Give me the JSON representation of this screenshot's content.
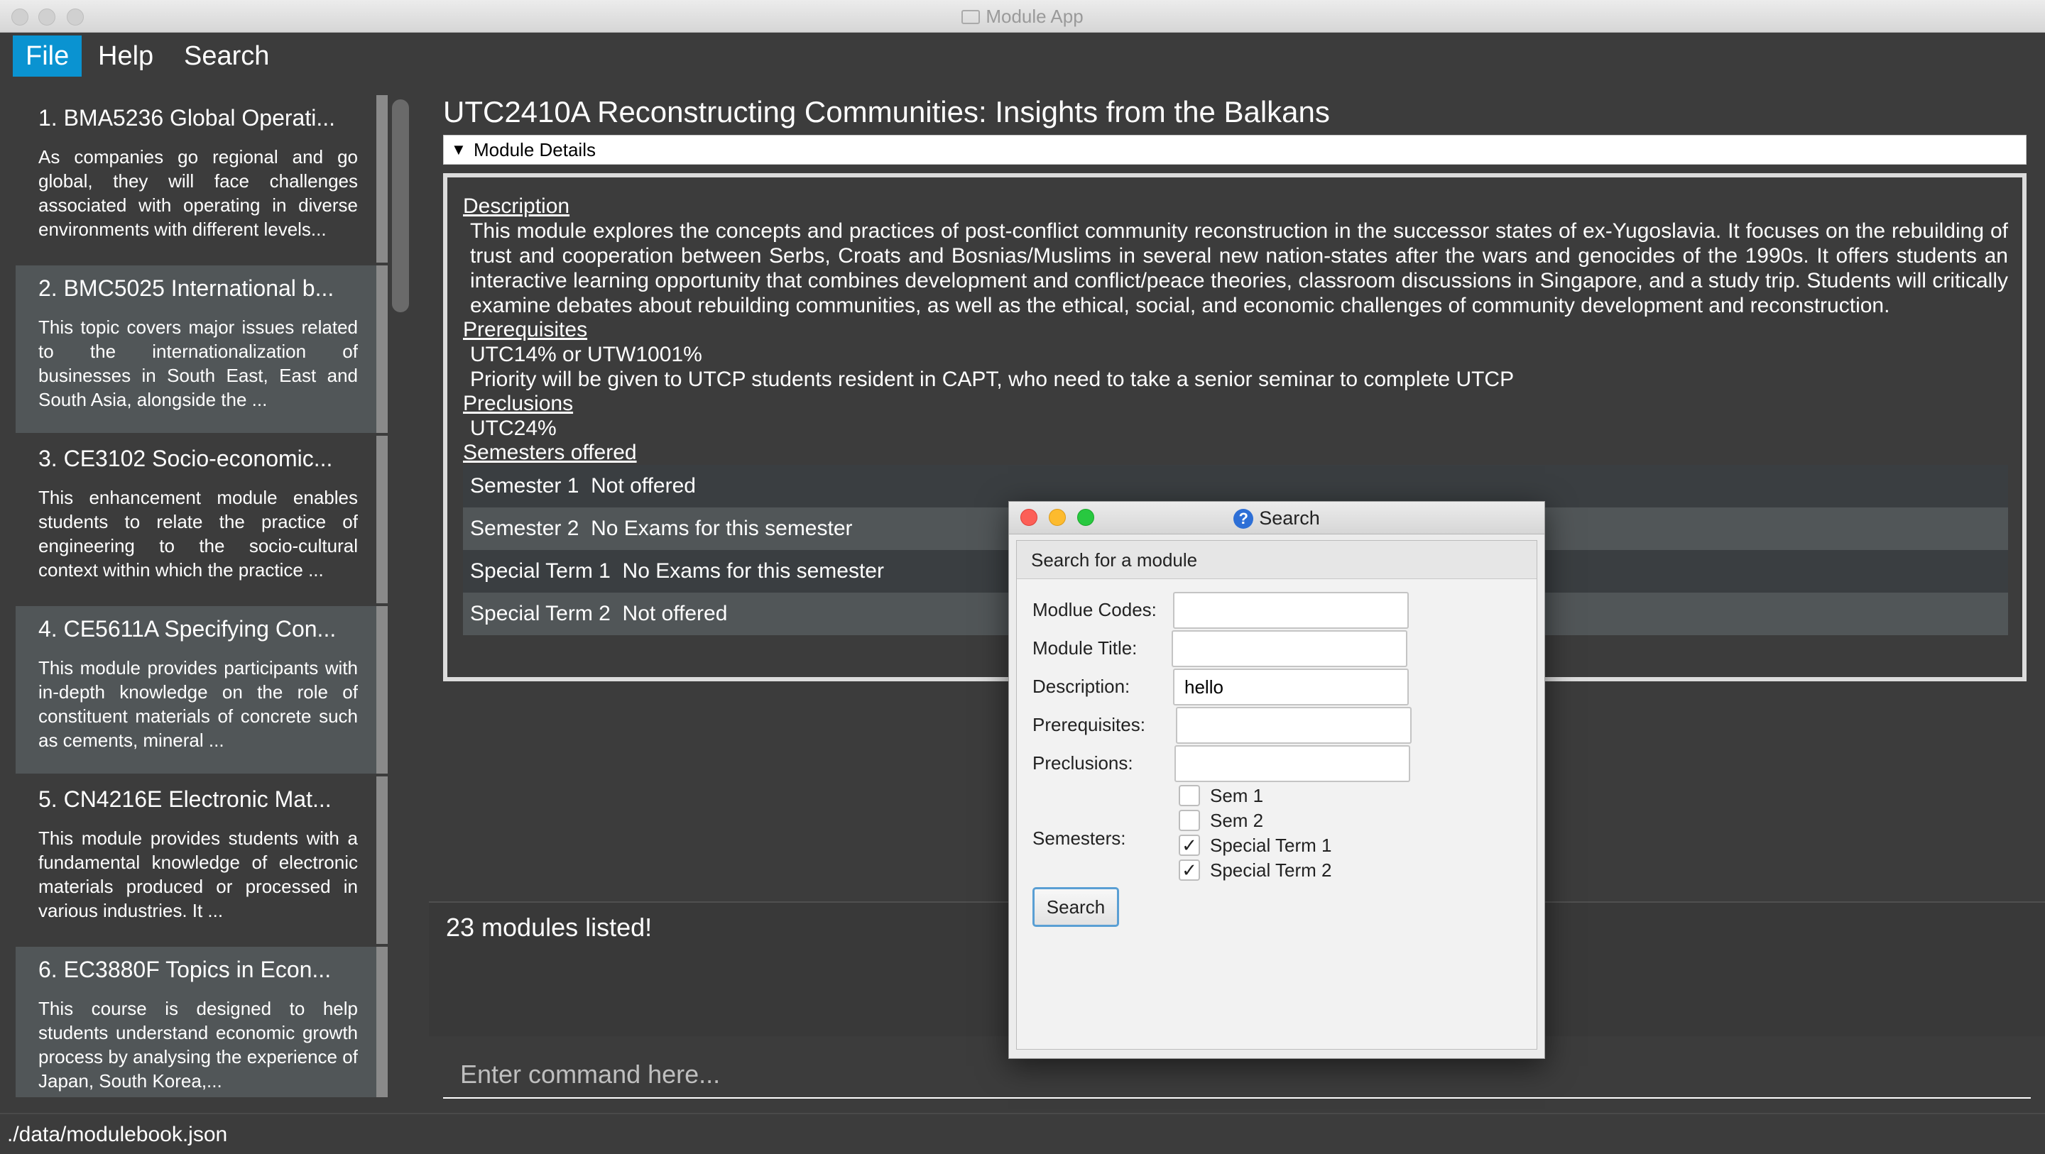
{
  "window": {
    "title": "Module App"
  },
  "menu": {
    "file": "File",
    "help": "Help",
    "search": "Search"
  },
  "modules": [
    {
      "title": "1.  BMA5236 Global Operati...",
      "desc": "As companies go regional and go global, they will face challenges associated with operating in diverse environments with different levels..."
    },
    {
      "title": "2.  BMC5025 International b...",
      "desc": "This topic covers major issues related to the internationalization of businesses in South East, East and South Asia, alongside the ..."
    },
    {
      "title": "3.  CE3102 Socio-economic...",
      "desc": "This enhancement module enables students to relate the practice of engineering to the socio-cultural context within which the practice ..."
    },
    {
      "title": "4.  CE5611A Specifying Con...",
      "desc": "This module provides participants with in-depth knowledge on the role of constituent materials of concrete such as cements, mineral ..."
    },
    {
      "title": "5.  CN4216E Electronic Mat...",
      "desc": "This module provides students with a fundamental knowledge of electronic materials produced or processed in various industries. It ..."
    },
    {
      "title": "6.  EC3880F Topics in Econ...",
      "desc": "This course is designed to help students understand economic growth process by analysing the experience of Japan, South Korea,..."
    }
  ],
  "module": {
    "heading": "UTC2410A Reconstructing Communities: Insights from the Balkans",
    "details_label": "Module Details",
    "description_label": "Description",
    "description": "This module explores the concepts and practices of post-conflict community reconstruction in the successor states of ex-Yugoslavia.  It focuses on the rebuilding of trust and cooperation between Serbs, Croats and Bosnias/Muslims in several new nation-states after the wars and genocides of the 1990s.  It offers students an interactive learning opportunity that combines development and conflict/peace theories, classroom discussions in Singapore, and a study trip. Students will critically examine debates about rebuilding communities, as well as the ethical, social, and economic challenges of community development and reconstruction.",
    "prerequisites_label": "Prerequisites",
    "prerequisites_line1": "UTC14% or UTW1001%",
    "prerequisites_line2": "Priority will be given to UTCP students resident in CAPT, who need to take a senior seminar to complete UTCP",
    "preclusions_label": "Preclusions",
    "preclusions": "UTC24%",
    "semesters_label": "Semesters offered",
    "semesters": [
      "Semester 1  Not offered",
      "Semester 2  No Exams for this semester",
      "Special Term 1  No Exams for this semester",
      "Special Term 2  Not offered"
    ]
  },
  "result": "23 modules listed!",
  "command": {
    "placeholder": "Enter command here..."
  },
  "status": {
    "path": "./data/modulebook.json"
  },
  "dialog": {
    "title": "Search",
    "icon": "question-icon",
    "section": "Search for a module",
    "fields": {
      "codes_label": "Modlue Codes:",
      "codes_value": "",
      "title_label": "Module Title:",
      "title_value": "",
      "description_label": "Description:",
      "description_value": "hello",
      "prerequisites_label": "Prerequisites:",
      "prerequisites_value": "",
      "preclusions_label": "Preclusions:",
      "preclusions_value": ""
    },
    "semesters_label": "Semesters:",
    "checkboxes": [
      {
        "label": "Sem 1",
        "checked": false
      },
      {
        "label": "Sem 2",
        "checked": false
      },
      {
        "label": "Special Term 1",
        "checked": true
      },
      {
        "label": "Special Term 2",
        "checked": true
      }
    ],
    "button": "Search"
  },
  "colors": {
    "accent": "#0a93d1",
    "background": "#3c3c3c",
    "card_alt": "#515658"
  }
}
